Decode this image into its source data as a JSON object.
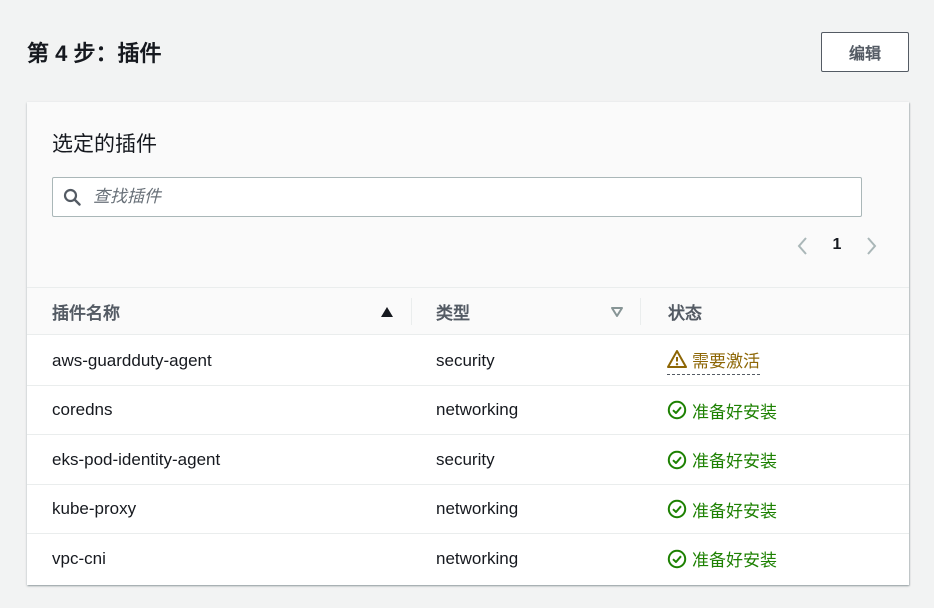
{
  "page": {
    "step_title": "第 4 步：插件",
    "edit_label": "编辑"
  },
  "panel": {
    "title": "选定的插件",
    "search_placeholder": "查找插件",
    "search_value": "",
    "current_page": "1"
  },
  "table": {
    "columns": [
      {
        "label": "插件名称",
        "sort": "ascending"
      },
      {
        "label": "类型",
        "sort": "none"
      },
      {
        "label": "状态",
        "sort": ""
      }
    ],
    "rows": [
      {
        "name": "aws-guardduty-agent",
        "type": "security",
        "status": "需要激活",
        "status_kind": "warning"
      },
      {
        "name": "coredns",
        "type": "networking",
        "status": "准备好安装",
        "status_kind": "success"
      },
      {
        "name": "eks-pod-identity-agent",
        "type": "security",
        "status": "准备好安装",
        "status_kind": "success"
      },
      {
        "name": "kube-proxy",
        "type": "networking",
        "status": "准备好安装",
        "status_kind": "success"
      },
      {
        "name": "vpc-cni",
        "type": "networking",
        "status": "准备好安装",
        "status_kind": "success"
      }
    ]
  },
  "colors": {
    "warning": "#8d6605",
    "success": "#1d8102",
    "text": "#16191f",
    "secondary_text": "#545b64",
    "border": "#eaeded"
  },
  "icons": {
    "search": "search-icon",
    "prev": "chevron-left-icon",
    "next": "chevron-right-icon",
    "sort_asc": "caret-up-filled-icon",
    "sort_none": "caret-down-outline-icon",
    "warning": "warning-triangle-icon",
    "success": "check-circle-icon"
  }
}
